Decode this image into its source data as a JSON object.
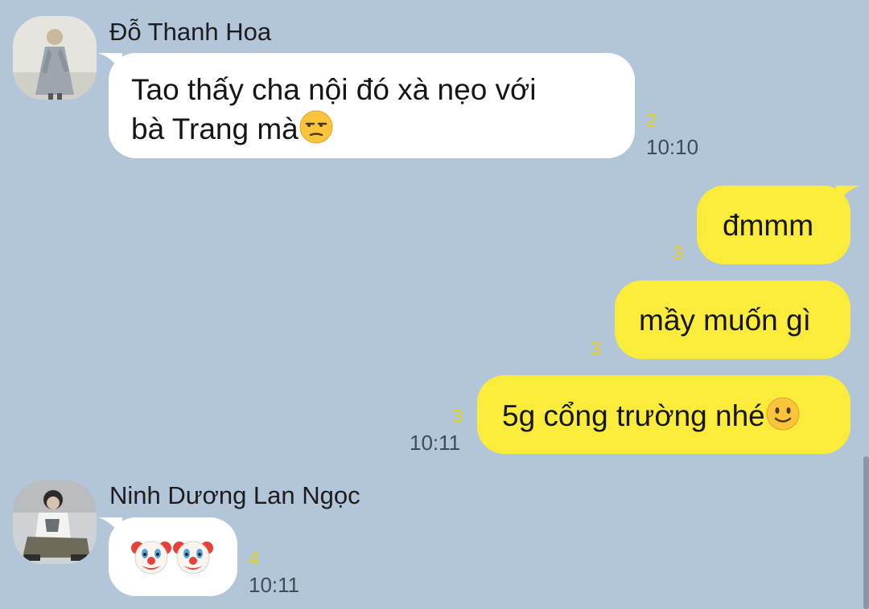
{
  "conversation": {
    "messages": [
      {
        "sender": "Đỗ Thanh Hoa",
        "lines": [
          "Tao thấy cha nội đó xà nẹo với",
          "bà Trang mà"
        ],
        "emoji_icon": "unamused-face-icon",
        "read_count": "2",
        "time": "10:10"
      },
      {
        "lines": [
          "đmmm"
        ],
        "read_count": "3"
      },
      {
        "lines": [
          "mầy muốn gì"
        ],
        "read_count": "3"
      },
      {
        "lines": [
          "5g cổng trường nhé"
        ],
        "emoji_icon": "slightly-smiling-face-icon",
        "read_count": "3",
        "time": "10:11"
      },
      {
        "sender": "Ninh Dương Lan Ngọc",
        "emoji_icons": [
          "clown-face-icon",
          "clown-face-icon"
        ],
        "read_count": "4",
        "time": "10:11"
      }
    ]
  },
  "colors": {
    "background": "#b2c5d9",
    "incoming_bubble": "#ffffff",
    "outgoing_bubble": "#fbeb3b",
    "read_count": "#e5d21f"
  }
}
